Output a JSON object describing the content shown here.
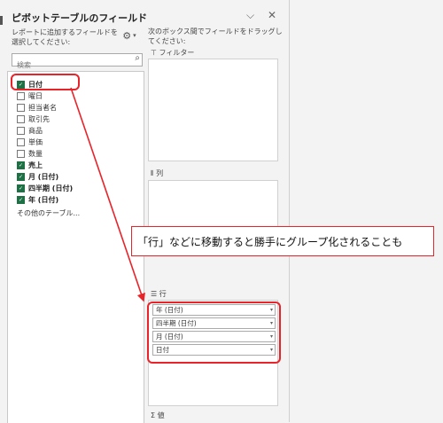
{
  "pane": {
    "title": "ピボットテーブルのフィールド",
    "chevron_icon": "chevron-down-icon",
    "close_icon": "close-icon",
    "instruction_left": "レポートに追加するフィールドを選択してください:",
    "gear_icon": "gear-icon",
    "gear_caret": "▾",
    "search_placeholder": "検索",
    "instruction_right": "次のボックス間でフィールドをドラッグしてください:",
    "fields": [
      {
        "label": "日付",
        "checked": true
      },
      {
        "label": "曜日",
        "checked": false
      },
      {
        "label": "担当者名",
        "checked": false
      },
      {
        "label": "取引先",
        "checked": false
      },
      {
        "label": "商品",
        "checked": false
      },
      {
        "label": "単価",
        "checked": false
      },
      {
        "label": "数量",
        "checked": false
      },
      {
        "label": "売上",
        "checked": true
      },
      {
        "label": "月 (日付)",
        "checked": true
      },
      {
        "label": "四半期 (日付)",
        "checked": true
      },
      {
        "label": "年 (日付)",
        "checked": true
      }
    ],
    "more_tables": "その他のテーブル...",
    "areas": {
      "filter_label": "フィルター",
      "columns_label": "列",
      "rows_label": "行",
      "values_label": "値",
      "row_items": [
        "年 (日付)",
        "四半期 (日付)",
        "月 (日付)",
        "日付"
      ]
    }
  },
  "callout": "「行」などに移動すると勝手にグループ化されることも",
  "colors": {
    "accent_red": "#e8232a",
    "check_green": "#1e7145"
  }
}
